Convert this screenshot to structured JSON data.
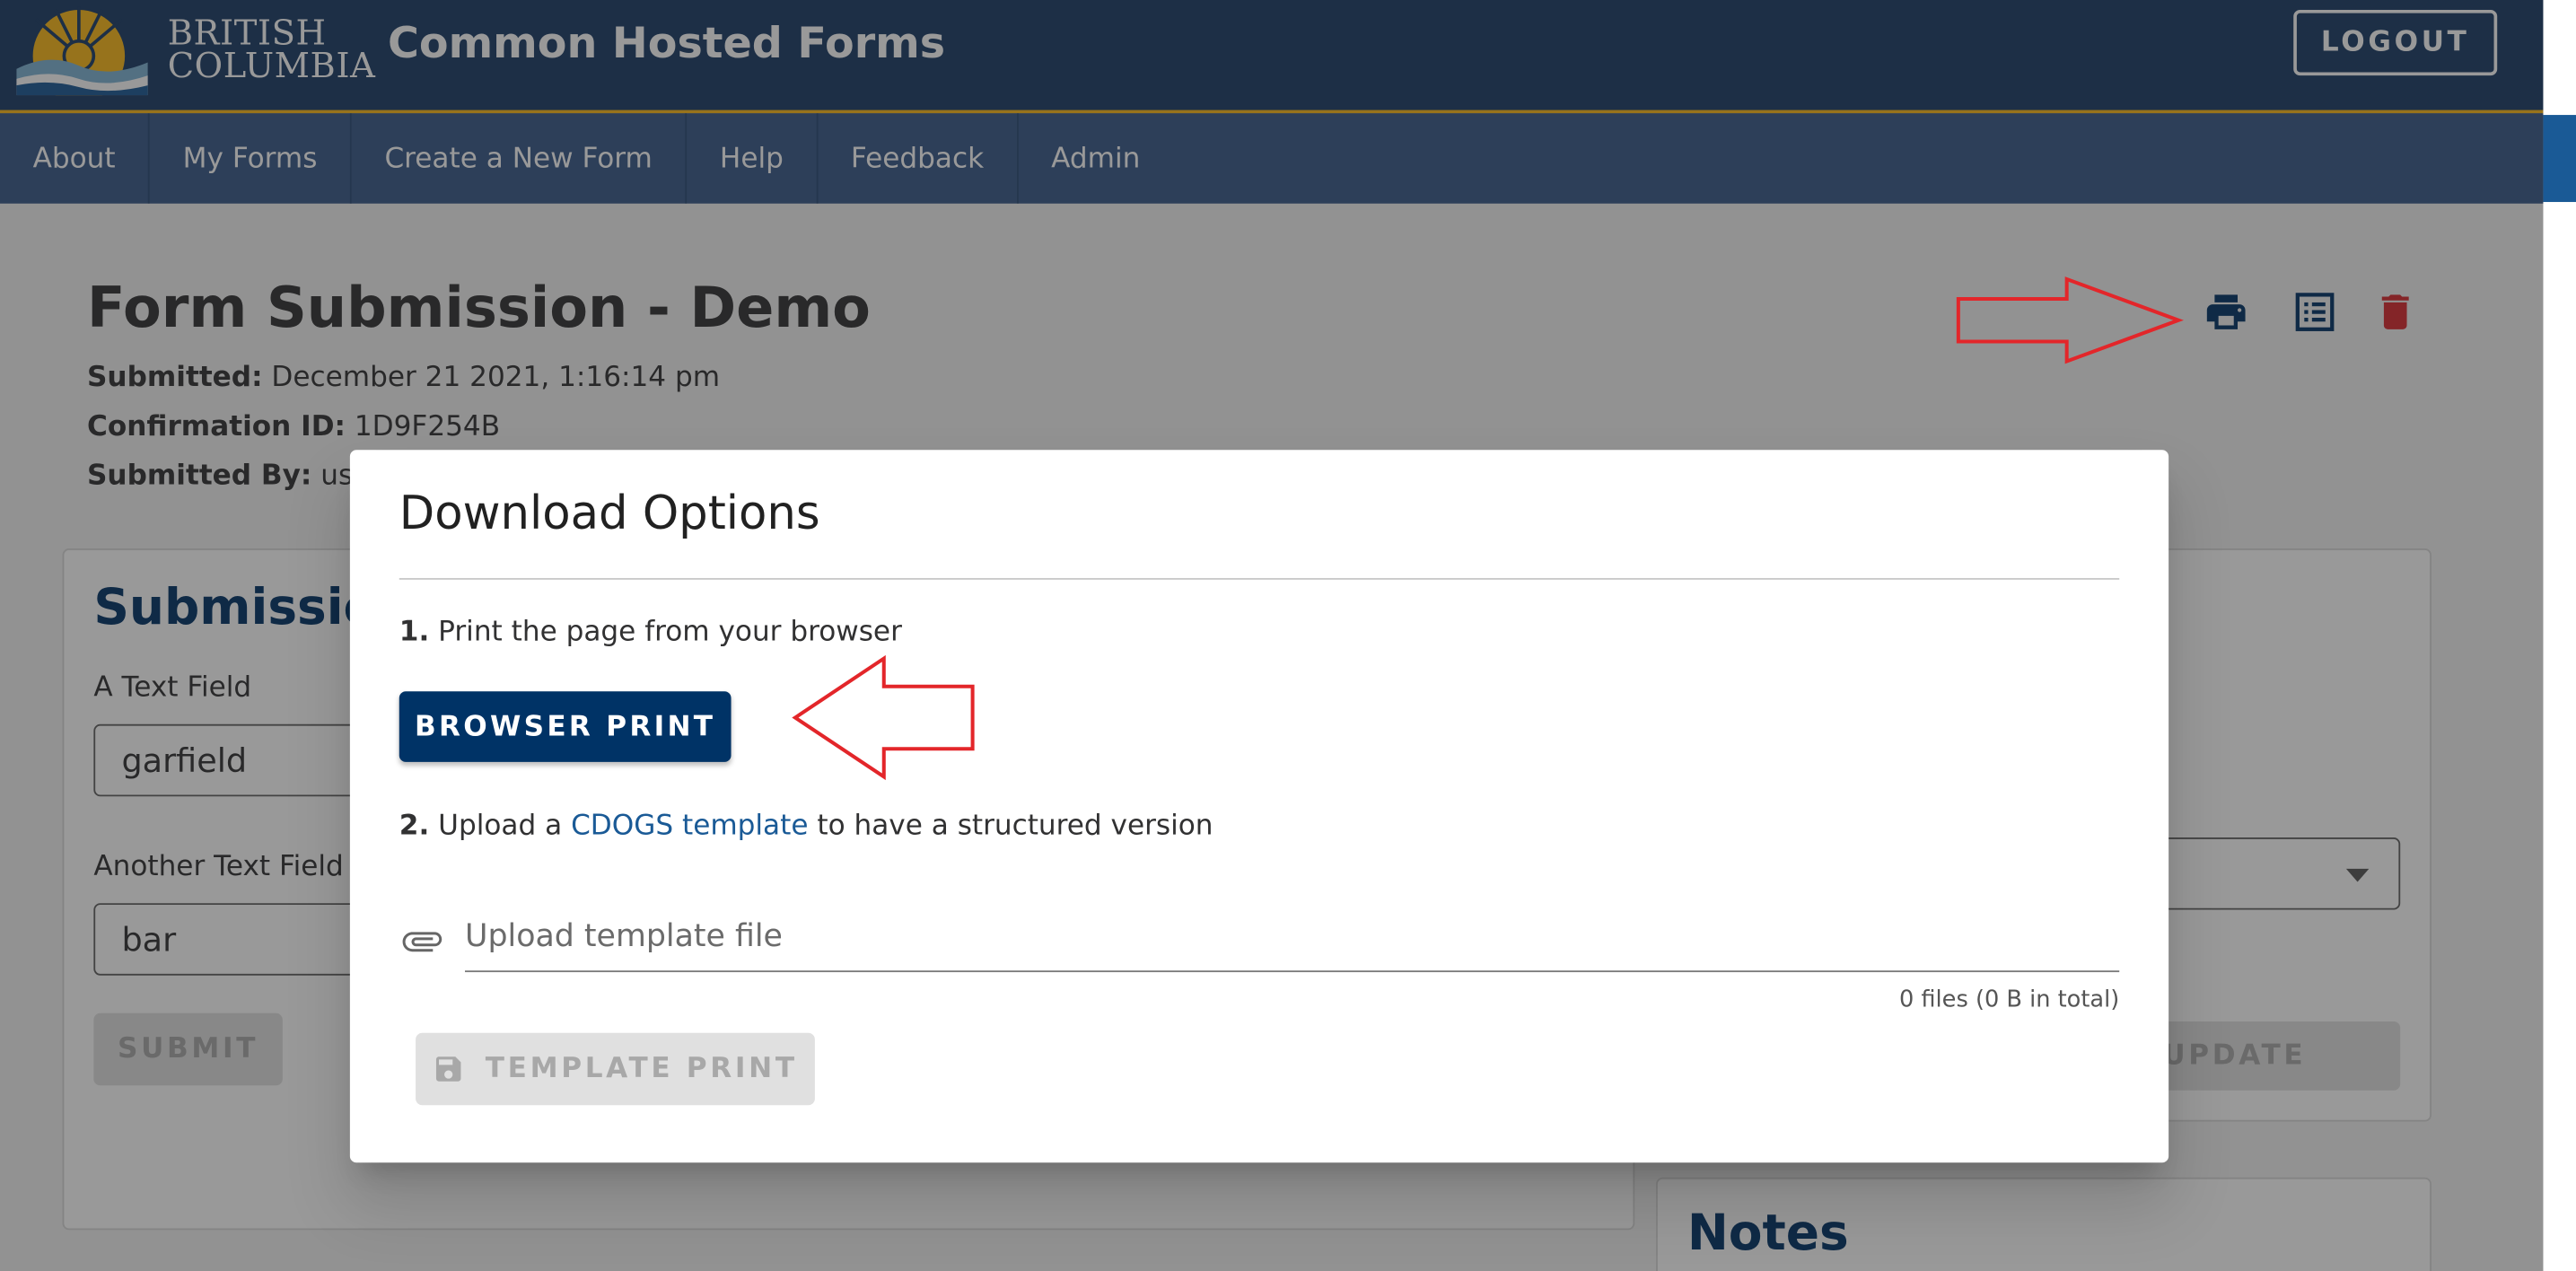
{
  "header": {
    "logo_line1": "BRITISH",
    "logo_line2": "COLUMBIA",
    "app_title": "Common Hosted Forms",
    "logout_label": "LOGOUT"
  },
  "nav": {
    "items": [
      {
        "label": "About"
      },
      {
        "label": "My Forms"
      },
      {
        "label": "Create a New Form"
      },
      {
        "label": "Help"
      },
      {
        "label": "Feedback"
      },
      {
        "label": "Admin"
      }
    ]
  },
  "page": {
    "title": "Form Submission - Demo",
    "submitted_label": "Submitted:",
    "submitted_value": "December 21 2021, 1:16:14 pm",
    "confirmation_label": "Confirmation ID:",
    "confirmation_value": "1D9F254B",
    "submitted_by_label": "Submitted By:",
    "submitted_by_value": "user",
    "icons": [
      "print-icon",
      "list-icon",
      "delete-icon"
    ],
    "delete_color": "#d8292f",
    "print_color": "#003366"
  },
  "submission_card": {
    "title": "Submission",
    "field1_label": "A Text Field",
    "field1_value": "garfield",
    "field2_label": "Another Text Field",
    "field2_value": "bar",
    "submit_label": "SUBMIT"
  },
  "status_card": {
    "update_label": "UPDATE"
  },
  "notes_card": {
    "title": "Notes"
  },
  "dialog": {
    "title": "Download Options",
    "step1_num": "1.",
    "step1_text": "Print the page from your browser",
    "browser_print_label": "BROWSER PRINT",
    "step2_num": "2.",
    "step2_pre": "Upload a",
    "step2_link": "CDOGS template",
    "step2_post": "to have a structured version",
    "upload_placeholder": "Upload template file",
    "file_count": "0 files (0 B in total)",
    "template_print_label": "TEMPLATE PRINT"
  },
  "colors": {
    "header_bg": "#1a3b66",
    "nav_bg": "#38598a",
    "primary_button": "#003366",
    "annotation_arrow": "#e3262a"
  }
}
